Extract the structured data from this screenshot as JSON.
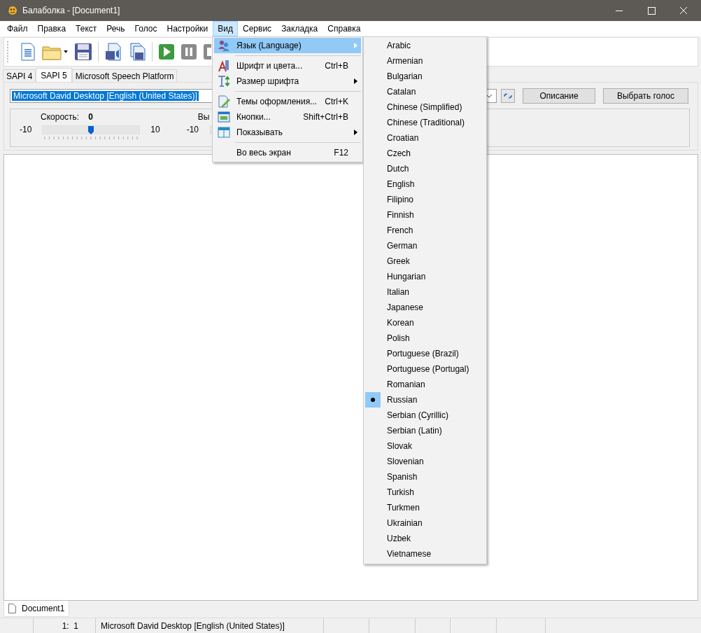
{
  "window": {
    "title": "Балаболка - [Document1]"
  },
  "menu_bar": [
    {
      "label": "Файл",
      "selected": false
    },
    {
      "label": "Правка",
      "selected": false
    },
    {
      "label": "Текст",
      "selected": false
    },
    {
      "label": "Речь",
      "selected": false
    },
    {
      "label": "Голос",
      "selected": false
    },
    {
      "label": "Настройки",
      "selected": false
    },
    {
      "label": "Вид",
      "selected": true
    },
    {
      "label": "Сервис",
      "selected": false
    },
    {
      "label": "Закладка",
      "selected": false
    },
    {
      "label": "Справка",
      "selected": false
    }
  ],
  "engine_tabs": [
    {
      "label": "SAPI 4",
      "selected": false
    },
    {
      "label": "SAPI 5",
      "selected": true
    },
    {
      "label": "Microsoft Speech Platform",
      "selected": false
    }
  ],
  "voice": {
    "value": "Microsoft David Desktop [English (United States)]"
  },
  "voice_buttons": [
    "Описание",
    "Выбрать голос"
  ],
  "speed": {
    "label": "Скорость:",
    "reading": "0",
    "min": "-10",
    "max": "10",
    "level": 0.5
  },
  "second_slider": {
    "label": "Вы",
    "min": "-10"
  },
  "view_menu": [
    {
      "kind": "item",
      "label": "Язык (Language)",
      "submenu": true,
      "selected": true
    },
    {
      "kind": "separator"
    },
    {
      "kind": "item",
      "label": "Шрифт и цвета...",
      "shortcut": "Ctrl+B",
      "submenu": false,
      "selected": false
    },
    {
      "kind": "item",
      "label": "Размер шрифта",
      "submenu": true,
      "selected": false
    },
    {
      "kind": "separator"
    },
    {
      "kind": "item",
      "label": "Темы оформления...",
      "shortcut": "Ctrl+K",
      "submenu": false,
      "selected": false
    },
    {
      "kind": "item",
      "label": "Кнопки...",
      "shortcut": "Shift+Ctrl+B",
      "submenu": false,
      "selected": false
    },
    {
      "kind": "item",
      "label": "Показывать",
      "submenu": true,
      "selected": false
    },
    {
      "kind": "separator"
    },
    {
      "kind": "item",
      "label": "Во весь экран",
      "shortcut": "F12",
      "submenu": false,
      "selected": false
    }
  ],
  "languages": [
    {
      "label": "Arabic",
      "selected": false
    },
    {
      "label": "Armenian",
      "selected": false
    },
    {
      "label": "Bulgarian",
      "selected": false
    },
    {
      "label": "Catalan",
      "selected": false
    },
    {
      "label": "Chinese (Simplified)",
      "selected": false
    },
    {
      "label": "Chinese (Traditional)",
      "selected": false
    },
    {
      "label": "Croatian",
      "selected": false
    },
    {
      "label": "Czech",
      "selected": false
    },
    {
      "label": "Dutch",
      "selected": false
    },
    {
      "label": "English",
      "selected": false
    },
    {
      "label": "Filipino",
      "selected": false
    },
    {
      "label": "Finnish",
      "selected": false
    },
    {
      "label": "French",
      "selected": false
    },
    {
      "label": "German",
      "selected": false
    },
    {
      "label": "Greek",
      "selected": false
    },
    {
      "label": "Hungarian",
      "selected": false
    },
    {
      "label": "Italian",
      "selected": false
    },
    {
      "label": "Japanese",
      "selected": false
    },
    {
      "label": "Korean",
      "selected": false
    },
    {
      "label": "Polish",
      "selected": false
    },
    {
      "label": "Portuguese (Brazil)",
      "selected": false
    },
    {
      "label": "Portuguese (Portugal)",
      "selected": false
    },
    {
      "label": "Romanian",
      "selected": false
    },
    {
      "label": "Russian",
      "selected": true
    },
    {
      "label": "Serbian (Cyrillic)",
      "selected": false
    },
    {
      "label": "Serbian (Latin)",
      "selected": false
    },
    {
      "label": "Slovak",
      "selected": false
    },
    {
      "label": "Slovenian",
      "selected": false
    },
    {
      "label": "Spanish",
      "selected": false
    },
    {
      "label": "Turkish",
      "selected": false
    },
    {
      "label": "Turkmen",
      "selected": false
    },
    {
      "label": "Ukrainian",
      "selected": false
    },
    {
      "label": "Uzbek",
      "selected": false
    },
    {
      "label": "Vietnamese",
      "selected": false
    }
  ],
  "document_tab": {
    "label": "Document1"
  },
  "status_bar": {
    "position": "1:  1",
    "voice": "Microsoft David Desktop [English (United States)]"
  }
}
